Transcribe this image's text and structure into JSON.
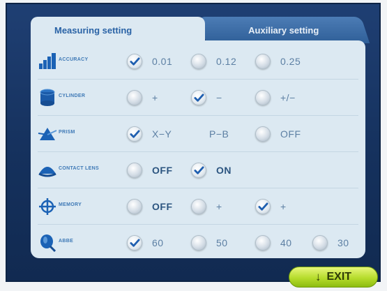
{
  "tabs": {
    "measuring": "Measuring setting",
    "auxiliary": "Auxiliary setting"
  },
  "rows": [
    {
      "label": "ACCURACY",
      "icon": "accuracy-bars-icon",
      "options": [
        "0.01",
        "0.12",
        "0.25"
      ],
      "selected": 0
    },
    {
      "label": "CYLINDER",
      "icon": "cylinder-icon",
      "options": [
        "+",
        "−",
        "+/−"
      ],
      "selected": 1
    },
    {
      "label": "PRISM",
      "icon": "prism-icon",
      "options": [
        "X−Y",
        "P−B",
        "OFF"
      ],
      "selected": 0
    },
    {
      "label": "CONTACT LENS",
      "icon": "contact-lens-icon",
      "options": [
        "OFF",
        "ON"
      ],
      "selected": 1
    },
    {
      "label": "MEMORY",
      "icon": "crosshair-icon",
      "options": [
        "OFF",
        "+",
        "+"
      ],
      "selected": 2
    },
    {
      "label": "ABBE",
      "icon": "lens-icon",
      "options": [
        "60",
        "50",
        "40",
        "30"
      ],
      "selected": 0
    }
  ],
  "exit": "EXIT",
  "colors": {
    "background": "#15315d",
    "panel": "#dce9f2",
    "accent": "#2a63a6",
    "exit_button": "#b6dc2c"
  }
}
